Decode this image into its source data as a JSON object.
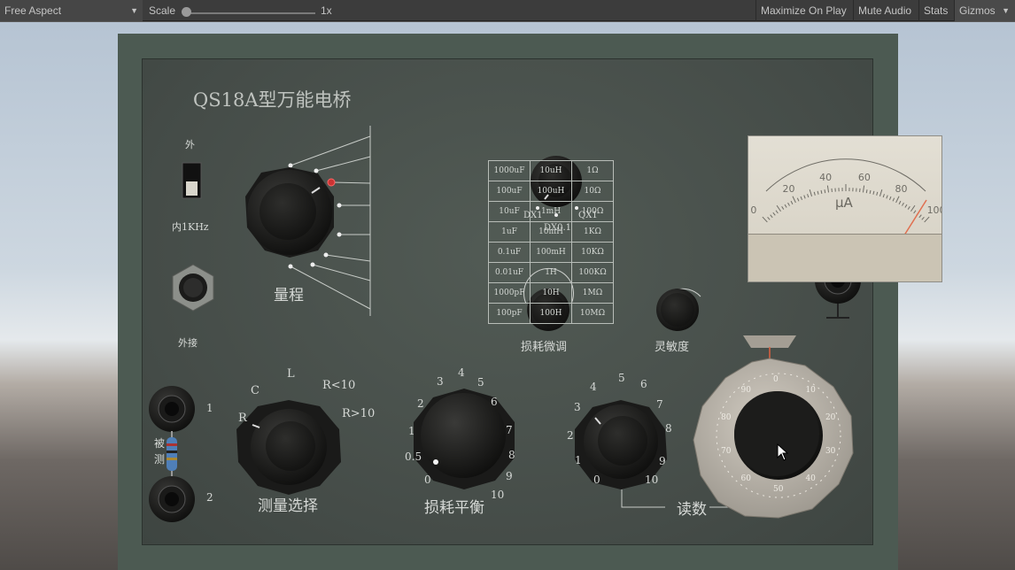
{
  "toolbar": {
    "aspect": "Free Aspect",
    "scale_label": "Scale",
    "scale_value": "1x",
    "maximize": "Maximize On Play",
    "mute": "Mute Audio",
    "stats": "Stats",
    "gizmos": "Gizmos"
  },
  "panel": {
    "title": "QS18A型万能电桥",
    "switch_top": "外",
    "switch_bottom": "内1KHz",
    "ext_label": "外接",
    "range_label": "量程",
    "multiplier": [
      "DX1",
      "DX0.1",
      "QX1"
    ],
    "loss_fine": "损耗微调",
    "sensitivity": "灵敏度",
    "measure_select": "测量选择",
    "measure_opts": [
      "R",
      "C",
      "L",
      "R<10",
      "R>10"
    ],
    "loss_balance": "损耗平衡",
    "loss_ticks": [
      "0",
      "0.5",
      "1",
      "2",
      "3",
      "4",
      "5",
      "6",
      "7",
      "8",
      "9",
      "10"
    ],
    "reading_ticks": [
      "0",
      "1",
      "2",
      "3",
      "4",
      "5",
      "6",
      "7",
      "8",
      "9",
      "10"
    ],
    "reading": "读数",
    "terminal_1": "1",
    "terminal_2": "2",
    "measured": "被测"
  },
  "range_table": [
    [
      "1000uF",
      "10uH",
      "1Ω"
    ],
    [
      "100uF",
      "100uH",
      "10Ω"
    ],
    [
      "10uF",
      "1mH",
      "100Ω"
    ],
    [
      "1uF",
      "10mH",
      "1KΩ"
    ],
    [
      "0.1uF",
      "100mH",
      "10KΩ"
    ],
    [
      "0.01uF",
      "1H",
      "100KΩ"
    ],
    [
      "1000pF",
      "10H",
      "1MΩ"
    ],
    [
      "100pF",
      "100H",
      "10MΩ"
    ]
  ],
  "meter": {
    "unit": "μA",
    "ticks": [
      "0",
      "20",
      "40",
      "60",
      "80",
      "100"
    ]
  },
  "dial": {
    "ticks": [
      "0",
      "10",
      "20",
      "30",
      "40",
      "50",
      "60",
      "70",
      "80",
      "90"
    ]
  }
}
